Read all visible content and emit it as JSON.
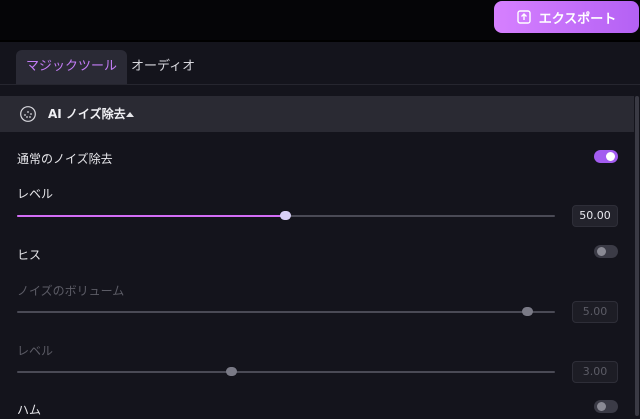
{
  "toolbar": {
    "export_label": "エクスポート",
    "export_icon": "upload-icon"
  },
  "tabs": [
    {
      "label": "マジックツール",
      "active": true
    },
    {
      "label": "オーディオ",
      "active": false
    }
  ],
  "section": {
    "title": "AI ノイズ除去",
    "icon": "noise-icon",
    "expanded": true
  },
  "controls": {
    "normal_denoise": {
      "label": "通常のノイズ除去",
      "enabled": true
    },
    "normal_level": {
      "label": "レベル",
      "value": "50.00",
      "level_percent": 50
    },
    "hiss": {
      "label": "ヒス",
      "enabled": false
    },
    "hiss_volume": {
      "label": "ノイズのボリューム",
      "value": "5.00",
      "level_percent": 95
    },
    "hiss_level": {
      "label": "レベル",
      "value": "3.00",
      "level_percent": 40
    },
    "hum": {
      "label": "ハム",
      "enabled": false
    }
  },
  "colors": {
    "accent": "#a35cf0",
    "export_gradient_start": "#d680ff",
    "export_gradient_end": "#b461f4"
  }
}
